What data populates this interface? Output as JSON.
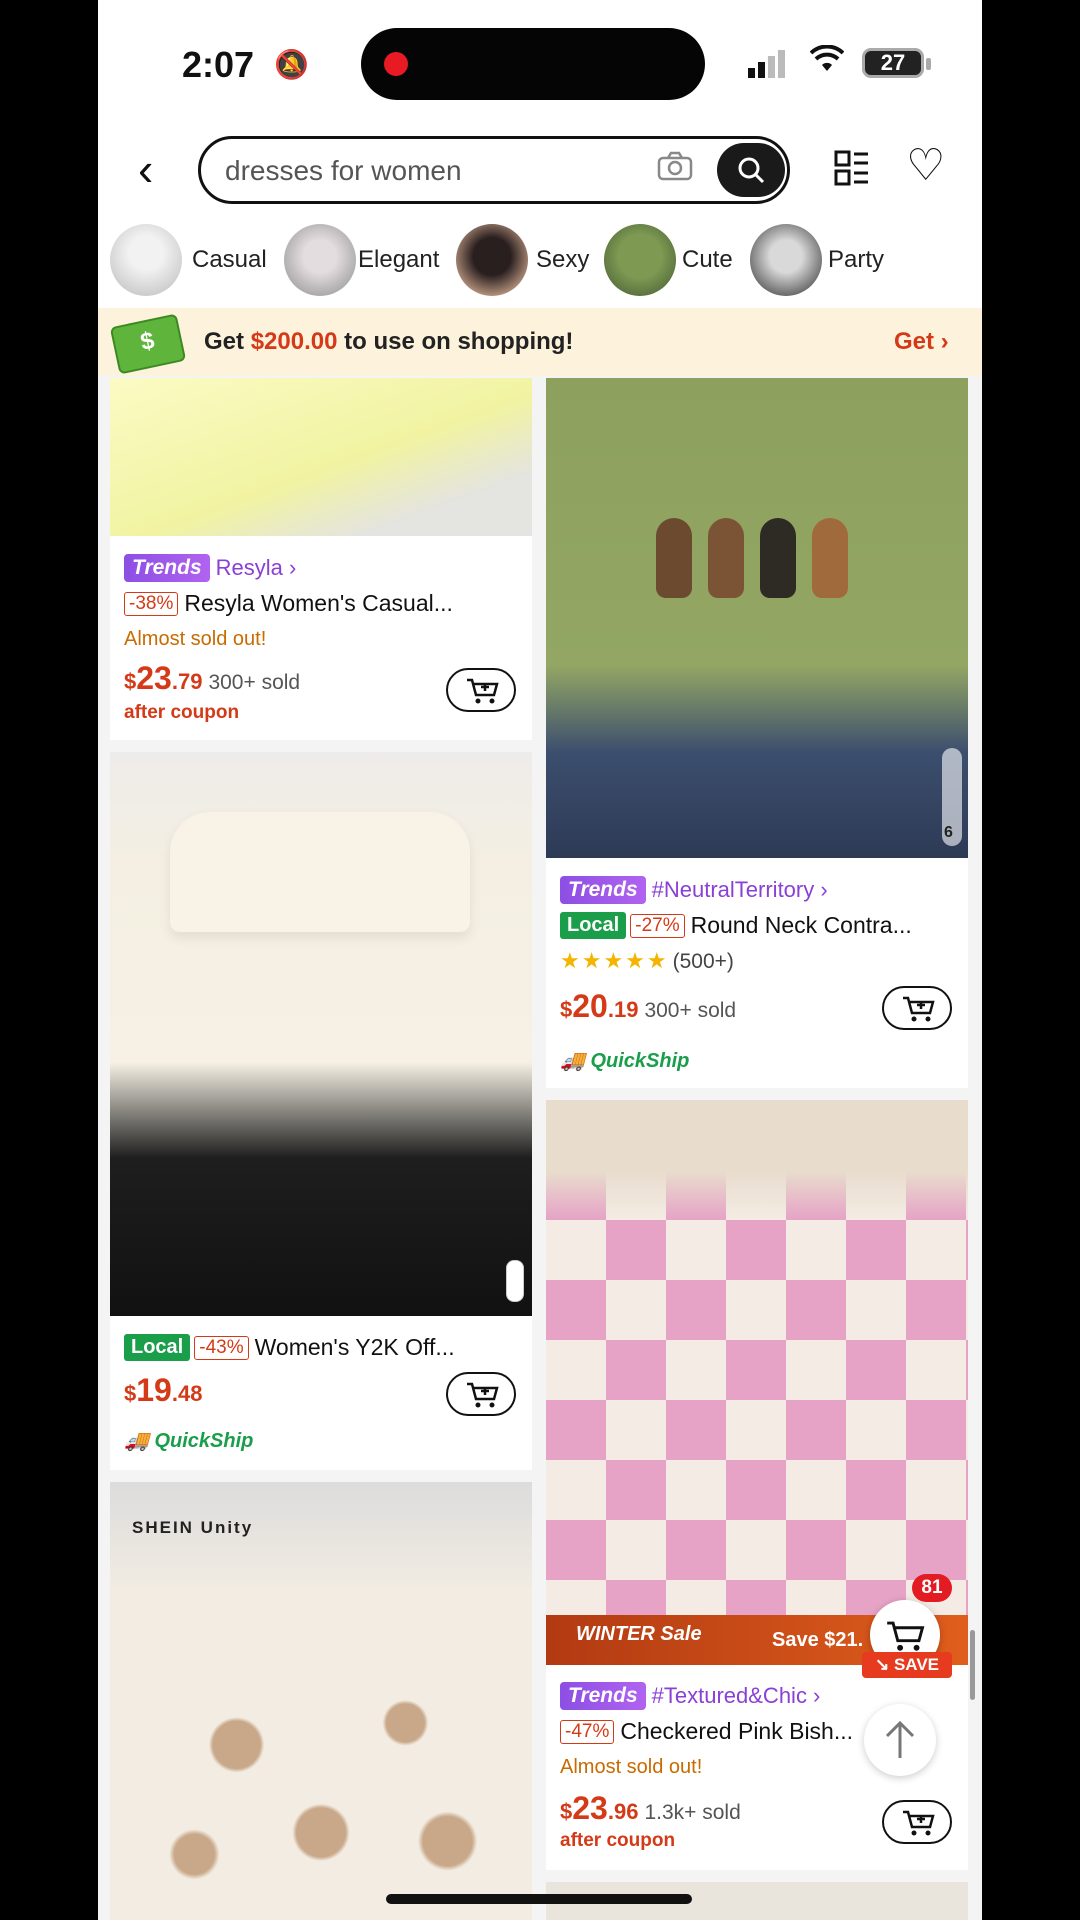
{
  "status": {
    "time": "2:07",
    "battery": "27"
  },
  "search": {
    "query": "dresses for women"
  },
  "categories": [
    {
      "label": "Casual"
    },
    {
      "label": "Elegant"
    },
    {
      "label": "Sexy"
    },
    {
      "label": "Cute"
    },
    {
      "label": "Party"
    }
  ],
  "promo": {
    "prefix": "Get ",
    "amount": "$200.00",
    "suffix": " to use on shopping!",
    "cta": "Get ›"
  },
  "products": {
    "p1": {
      "badge": "Trends",
      "store": "Resyla ›",
      "discount": "-38%",
      "title": "Resyla Women's Casual...",
      "note": "Almost sold out!",
      "currency": "$",
      "price_int": "23",
      "price_dec": ".79",
      "sold": "300+ sold",
      "after": "after coupon"
    },
    "p2": {
      "badge": "Trends",
      "store": "#NeutralTerritory ›",
      "local": "Local",
      "discount": "-27%",
      "title": "Round Neck Contra...",
      "rating_count": "(500+)",
      "currency": "$",
      "price_int": "20",
      "price_dec": ".19",
      "sold": "300+ sold",
      "quickship": "QuickShip",
      "swatch_count": "6"
    },
    "p3": {
      "local": "Local",
      "discount": "-43%",
      "title": "Women's Y2K Off...",
      "currency": "$",
      "price_int": "19",
      "price_dec": ".48",
      "quickship": "QuickShip"
    },
    "p4": {
      "badge": "Trends",
      "store": "#Textured&Chic ›",
      "discount": "-47%",
      "title": "Checkered Pink Bish...",
      "note": "Almost sold out!",
      "currency": "$",
      "price_int": "23",
      "price_dec": ".96",
      "sold": "1.3k+ sold",
      "after": "after coupon",
      "banner": "WINTER Sale",
      "banner_save": "Save $21."
    },
    "p5": {
      "brand": "SHEIN Unity"
    }
  },
  "floating": {
    "cart_count": "81",
    "save_label": "↘ SAVE"
  },
  "colors": {
    "accent": "#d43a17",
    "trends": "#8c4fe3",
    "local": "#1a9e4a"
  }
}
